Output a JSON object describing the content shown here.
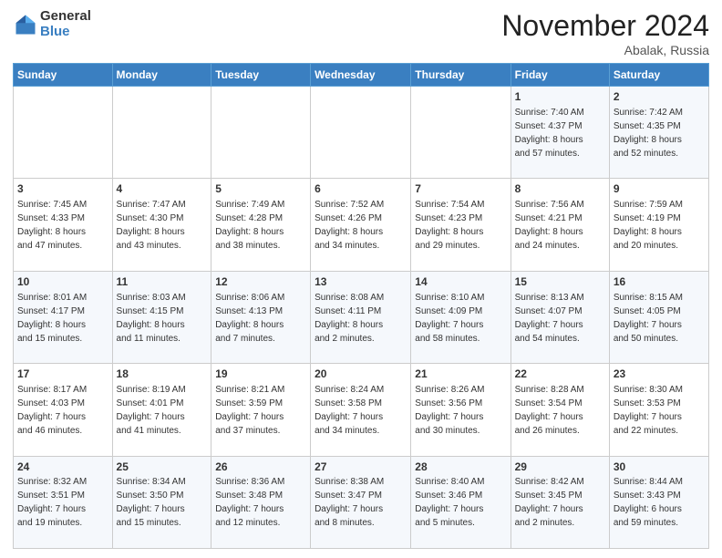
{
  "logo": {
    "general": "General",
    "blue": "Blue"
  },
  "header": {
    "month": "November 2024",
    "location": "Abalak, Russia"
  },
  "weekdays": [
    "Sunday",
    "Monday",
    "Tuesday",
    "Wednesday",
    "Thursday",
    "Friday",
    "Saturday"
  ],
  "weeks": [
    [
      {
        "day": "",
        "info": ""
      },
      {
        "day": "",
        "info": ""
      },
      {
        "day": "",
        "info": ""
      },
      {
        "day": "",
        "info": ""
      },
      {
        "day": "",
        "info": ""
      },
      {
        "day": "1",
        "info": "Sunrise: 7:40 AM\nSunset: 4:37 PM\nDaylight: 8 hours\nand 57 minutes."
      },
      {
        "day": "2",
        "info": "Sunrise: 7:42 AM\nSunset: 4:35 PM\nDaylight: 8 hours\nand 52 minutes."
      }
    ],
    [
      {
        "day": "3",
        "info": "Sunrise: 7:45 AM\nSunset: 4:33 PM\nDaylight: 8 hours\nand 47 minutes."
      },
      {
        "day": "4",
        "info": "Sunrise: 7:47 AM\nSunset: 4:30 PM\nDaylight: 8 hours\nand 43 minutes."
      },
      {
        "day": "5",
        "info": "Sunrise: 7:49 AM\nSunset: 4:28 PM\nDaylight: 8 hours\nand 38 minutes."
      },
      {
        "day": "6",
        "info": "Sunrise: 7:52 AM\nSunset: 4:26 PM\nDaylight: 8 hours\nand 34 minutes."
      },
      {
        "day": "7",
        "info": "Sunrise: 7:54 AM\nSunset: 4:23 PM\nDaylight: 8 hours\nand 29 minutes."
      },
      {
        "day": "8",
        "info": "Sunrise: 7:56 AM\nSunset: 4:21 PM\nDaylight: 8 hours\nand 24 minutes."
      },
      {
        "day": "9",
        "info": "Sunrise: 7:59 AM\nSunset: 4:19 PM\nDaylight: 8 hours\nand 20 minutes."
      }
    ],
    [
      {
        "day": "10",
        "info": "Sunrise: 8:01 AM\nSunset: 4:17 PM\nDaylight: 8 hours\nand 15 minutes."
      },
      {
        "day": "11",
        "info": "Sunrise: 8:03 AM\nSunset: 4:15 PM\nDaylight: 8 hours\nand 11 minutes."
      },
      {
        "day": "12",
        "info": "Sunrise: 8:06 AM\nSunset: 4:13 PM\nDaylight: 8 hours\nand 7 minutes."
      },
      {
        "day": "13",
        "info": "Sunrise: 8:08 AM\nSunset: 4:11 PM\nDaylight: 8 hours\nand 2 minutes."
      },
      {
        "day": "14",
        "info": "Sunrise: 8:10 AM\nSunset: 4:09 PM\nDaylight: 7 hours\nand 58 minutes."
      },
      {
        "day": "15",
        "info": "Sunrise: 8:13 AM\nSunset: 4:07 PM\nDaylight: 7 hours\nand 54 minutes."
      },
      {
        "day": "16",
        "info": "Sunrise: 8:15 AM\nSunset: 4:05 PM\nDaylight: 7 hours\nand 50 minutes."
      }
    ],
    [
      {
        "day": "17",
        "info": "Sunrise: 8:17 AM\nSunset: 4:03 PM\nDaylight: 7 hours\nand 46 minutes."
      },
      {
        "day": "18",
        "info": "Sunrise: 8:19 AM\nSunset: 4:01 PM\nDaylight: 7 hours\nand 41 minutes."
      },
      {
        "day": "19",
        "info": "Sunrise: 8:21 AM\nSunset: 3:59 PM\nDaylight: 7 hours\nand 37 minutes."
      },
      {
        "day": "20",
        "info": "Sunrise: 8:24 AM\nSunset: 3:58 PM\nDaylight: 7 hours\nand 34 minutes."
      },
      {
        "day": "21",
        "info": "Sunrise: 8:26 AM\nSunset: 3:56 PM\nDaylight: 7 hours\nand 30 minutes."
      },
      {
        "day": "22",
        "info": "Sunrise: 8:28 AM\nSunset: 3:54 PM\nDaylight: 7 hours\nand 26 minutes."
      },
      {
        "day": "23",
        "info": "Sunrise: 8:30 AM\nSunset: 3:53 PM\nDaylight: 7 hours\nand 22 minutes."
      }
    ],
    [
      {
        "day": "24",
        "info": "Sunrise: 8:32 AM\nSunset: 3:51 PM\nDaylight: 7 hours\nand 19 minutes."
      },
      {
        "day": "25",
        "info": "Sunrise: 8:34 AM\nSunset: 3:50 PM\nDaylight: 7 hours\nand 15 minutes."
      },
      {
        "day": "26",
        "info": "Sunrise: 8:36 AM\nSunset: 3:48 PM\nDaylight: 7 hours\nand 12 minutes."
      },
      {
        "day": "27",
        "info": "Sunrise: 8:38 AM\nSunset: 3:47 PM\nDaylight: 7 hours\nand 8 minutes."
      },
      {
        "day": "28",
        "info": "Sunrise: 8:40 AM\nSunset: 3:46 PM\nDaylight: 7 hours\nand 5 minutes."
      },
      {
        "day": "29",
        "info": "Sunrise: 8:42 AM\nSunset: 3:45 PM\nDaylight: 7 hours\nand 2 minutes."
      },
      {
        "day": "30",
        "info": "Sunrise: 8:44 AM\nSunset: 3:43 PM\nDaylight: 6 hours\nand 59 minutes."
      }
    ]
  ]
}
